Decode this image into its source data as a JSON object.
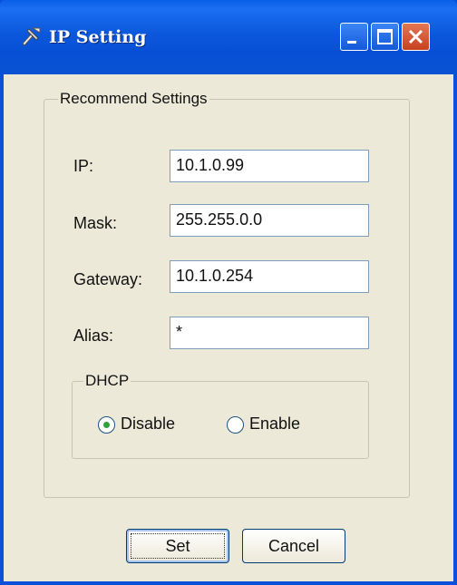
{
  "window": {
    "title": "IP Setting",
    "icon": "tools-icon"
  },
  "group": {
    "title": "Recommend Settings"
  },
  "fields": {
    "ip": {
      "label": "IP:",
      "value": "10.1.0.99"
    },
    "mask": {
      "label": "Mask:",
      "value": "255.255.0.0"
    },
    "gateway": {
      "label": "Gateway:",
      "value": "10.1.0.254"
    },
    "alias": {
      "label": "Alias:",
      "value": "*"
    }
  },
  "dhcp": {
    "title": "DHCP",
    "options": [
      {
        "label": "Disable",
        "selected": true
      },
      {
        "label": "Enable",
        "selected": false
      }
    ]
  },
  "buttons": {
    "set": "Set",
    "cancel": "Cancel"
  }
}
